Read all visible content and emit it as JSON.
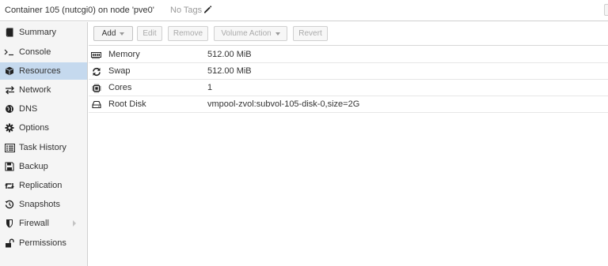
{
  "header": {
    "title": "Container 105 (nutcgi0) on node 'pve0'",
    "tags": "No Tags",
    "edit_tags_icon": "pencil-icon"
  },
  "sidebar": {
    "items": [
      {
        "label": "Summary",
        "icon": "book-icon"
      },
      {
        "label": "Console",
        "icon": "terminal-icon"
      },
      {
        "label": "Resources",
        "icon": "cube-icon",
        "active": true
      },
      {
        "label": "Network",
        "icon": "exchange-icon"
      },
      {
        "label": "DNS",
        "icon": "globe-icon"
      },
      {
        "label": "Options",
        "icon": "gear-icon"
      },
      {
        "label": "Task History",
        "icon": "list-icon"
      },
      {
        "label": "Backup",
        "icon": "floppy-icon"
      },
      {
        "label": "Replication",
        "icon": "retweet-icon"
      },
      {
        "label": "Snapshots",
        "icon": "history-icon"
      },
      {
        "label": "Firewall",
        "icon": "shield-icon",
        "expandable": true
      },
      {
        "label": "Permissions",
        "icon": "unlock-icon"
      }
    ]
  },
  "toolbar": {
    "add": "Add",
    "edit": "Edit",
    "remove": "Remove",
    "volume_action": "Volume Action",
    "revert": "Revert"
  },
  "resources": [
    {
      "key": "Memory",
      "value": "512.00 MiB",
      "icon": "memory-icon"
    },
    {
      "key": "Swap",
      "value": "512.00 MiB",
      "icon": "refresh-icon"
    },
    {
      "key": "Cores",
      "value": "1",
      "icon": "cpu-icon"
    },
    {
      "key": "Root Disk",
      "value": "vmpool-zvol:subvol-105-disk-0,size=2G",
      "icon": "hdd-icon"
    }
  ],
  "colors": {
    "active_nav": "#c5d9ee",
    "sidebar_bg": "#f5f5f5",
    "border": "#d0d0d0"
  }
}
